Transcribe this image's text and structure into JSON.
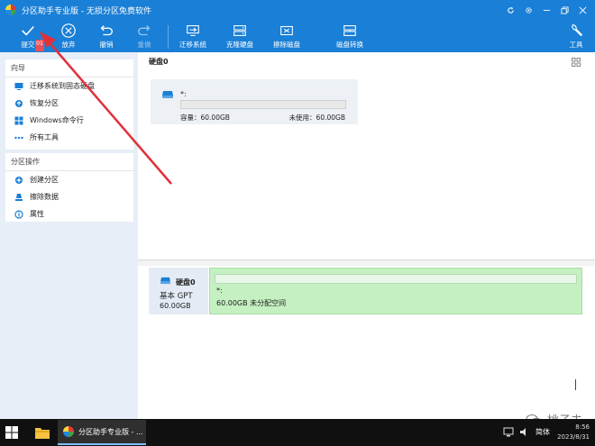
{
  "window": {
    "title": "分区助手专业版 - 无损分区免费软件"
  },
  "toolbar": {
    "commit": "提交",
    "discard": "放弃",
    "undo": "撤销",
    "redo": "重做",
    "migrate_os": "迁移系统",
    "clone_disk": "克隆硬盘",
    "wipe_disk": "擦除磁盘",
    "disk_convert": "磁盘转换",
    "tools": "工具",
    "pending_count": "01"
  },
  "sidebar": {
    "wizard": {
      "header": "向导",
      "items": [
        {
          "label": "迁移系统到固态硬盘",
          "icon": "migrate-icon"
        },
        {
          "label": "恢复分区",
          "icon": "recover-icon"
        },
        {
          "label": "Windows命令行",
          "icon": "windows-icon"
        },
        {
          "label": "所有工具",
          "icon": "more-icon"
        }
      ]
    },
    "partition_ops": {
      "header": "分区操作",
      "items": [
        {
          "label": "创建分区",
          "icon": "create-partition-icon"
        },
        {
          "label": "擦除数据",
          "icon": "wipe-data-icon"
        },
        {
          "label": "属性",
          "icon": "info-icon"
        }
      ]
    }
  },
  "disk_map": {
    "heading": "硬盘0",
    "card": {
      "name": "*:",
      "capacity": "容量：60.00GB",
      "free": "未使用：60.00GB"
    }
  },
  "disk_list": {
    "disk": {
      "name": "硬盘0",
      "type": "基本 GPT",
      "size": "60.00GB"
    },
    "partition": {
      "name": "*:",
      "info": "60.00GB 未分配空间"
    }
  },
  "taskbar": {
    "task_title": "分区助手专业版 - ...",
    "lang": "简体",
    "time": "8:56",
    "date": "2023/8/31"
  },
  "watermark": "桃子夫",
  "colors": {
    "accent": "#1a7fd6",
    "partition_fill": "#c4f0c2",
    "badge": "#e8505b",
    "annotation_arrow": "#e0313a"
  }
}
